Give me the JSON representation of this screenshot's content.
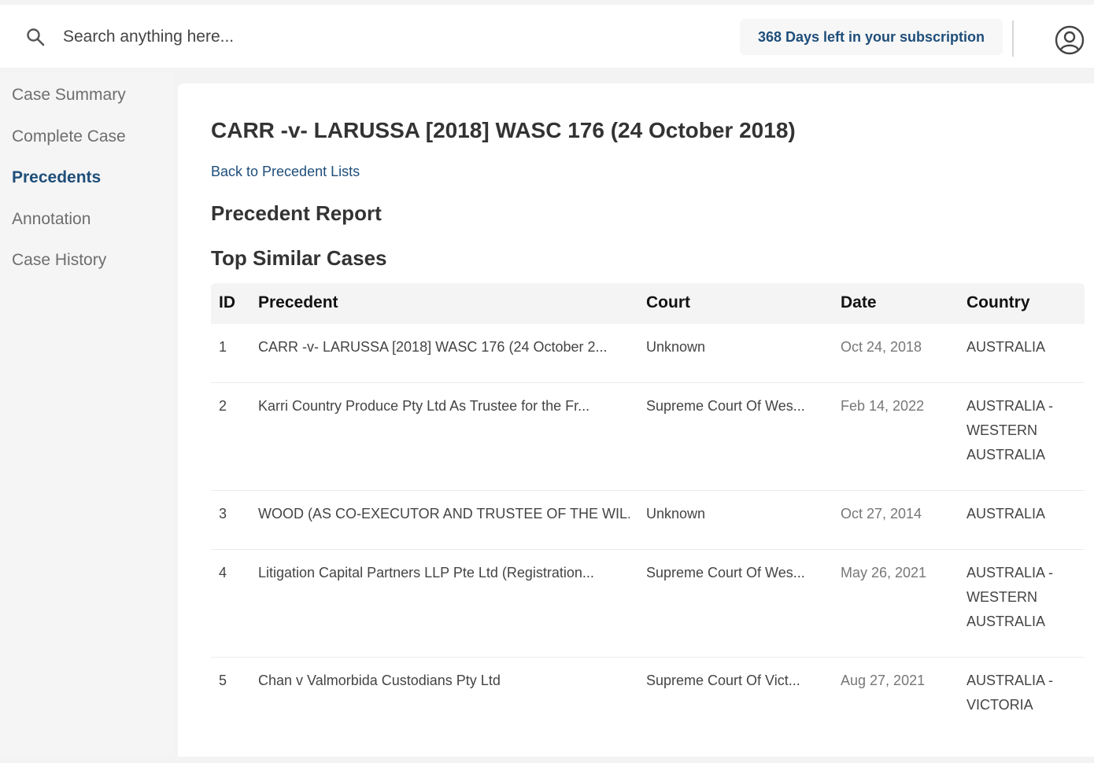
{
  "search": {
    "placeholder": "Search anything here..."
  },
  "subscription": {
    "text": "368 Days left in your subscription"
  },
  "sidebar": {
    "items": [
      {
        "label": "Case Summary",
        "active": false
      },
      {
        "label": "Complete Case",
        "active": false
      },
      {
        "label": "Precedents",
        "active": true
      },
      {
        "label": "Annotation",
        "active": false
      },
      {
        "label": "Case History",
        "active": false
      }
    ]
  },
  "main": {
    "case_title": "CARR -v- LARUSSA [2018] WASC 176 (24 October 2018)",
    "back_link": "Back to Precedent Lists",
    "report_title": "Precedent Report",
    "similar_title": "Top Similar Cases"
  },
  "table": {
    "headers": {
      "id": "ID",
      "precedent": "Precedent",
      "court": "Court",
      "date": "Date",
      "country": "Country"
    },
    "rows": [
      {
        "id": "1",
        "precedent": "CARR -v- LARUSSA [2018] WASC 176 (24 October 2...",
        "court": "Unknown",
        "date": "Oct 24, 2018",
        "country": "AUSTRALIA"
      },
      {
        "id": "2",
        "precedent": "Karri Country Produce Pty Ltd As Trustee for the Fr...",
        "court": "Supreme Court Of Wes...",
        "date": "Feb 14, 2022",
        "country": "AUSTRALIA - WESTERN AUSTRALIA"
      },
      {
        "id": "3",
        "precedent": "WOOD (AS CO-EXECUTOR AND TRUSTEE OF THE WIL...",
        "court": "Unknown",
        "date": "Oct 27, 2014",
        "country": "AUSTRALIA"
      },
      {
        "id": "4",
        "precedent": "Litigation Capital Partners LLP Pte Ltd (Registration...",
        "court": "Supreme Court Of Wes...",
        "date": "May 26, 2021",
        "country": "AUSTRALIA - WESTERN AUSTRALIA"
      },
      {
        "id": "5",
        "precedent": "Chan v Valmorbida Custodians Pty Ltd",
        "court": "Supreme Court Of Vict...",
        "date": "Aug 27, 2021",
        "country": "AUSTRALIA - VICTORIA"
      }
    ]
  },
  "colors": {
    "accent": "#1f4e7a",
    "sidebar_text": "#6e6e6e"
  }
}
